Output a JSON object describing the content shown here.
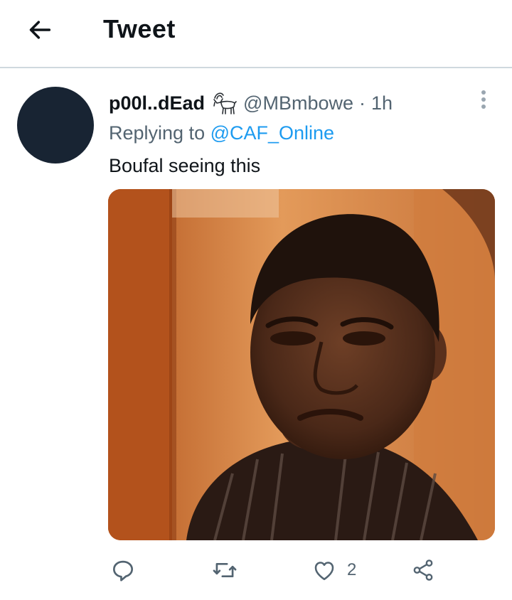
{
  "header": {
    "title": "Tweet",
    "back_icon": "arrow-left-icon"
  },
  "tweet": {
    "display_name": "p00l..dEad",
    "name_emoji_icon": "goat-icon",
    "handle": "@MBmbowe",
    "separator": "·",
    "time": "1h",
    "reply_prefix": "Replying to ",
    "reply_to": "@CAF_Online",
    "text": "Boufal seeing this",
    "avatar_color": "#182433",
    "link_color": "#1d9bf0"
  },
  "actions": {
    "reply_icon": "reply-icon",
    "retweet_icon": "retweet-icon",
    "like_icon": "heart-icon",
    "like_count": "2",
    "share_icon": "share-icon"
  }
}
